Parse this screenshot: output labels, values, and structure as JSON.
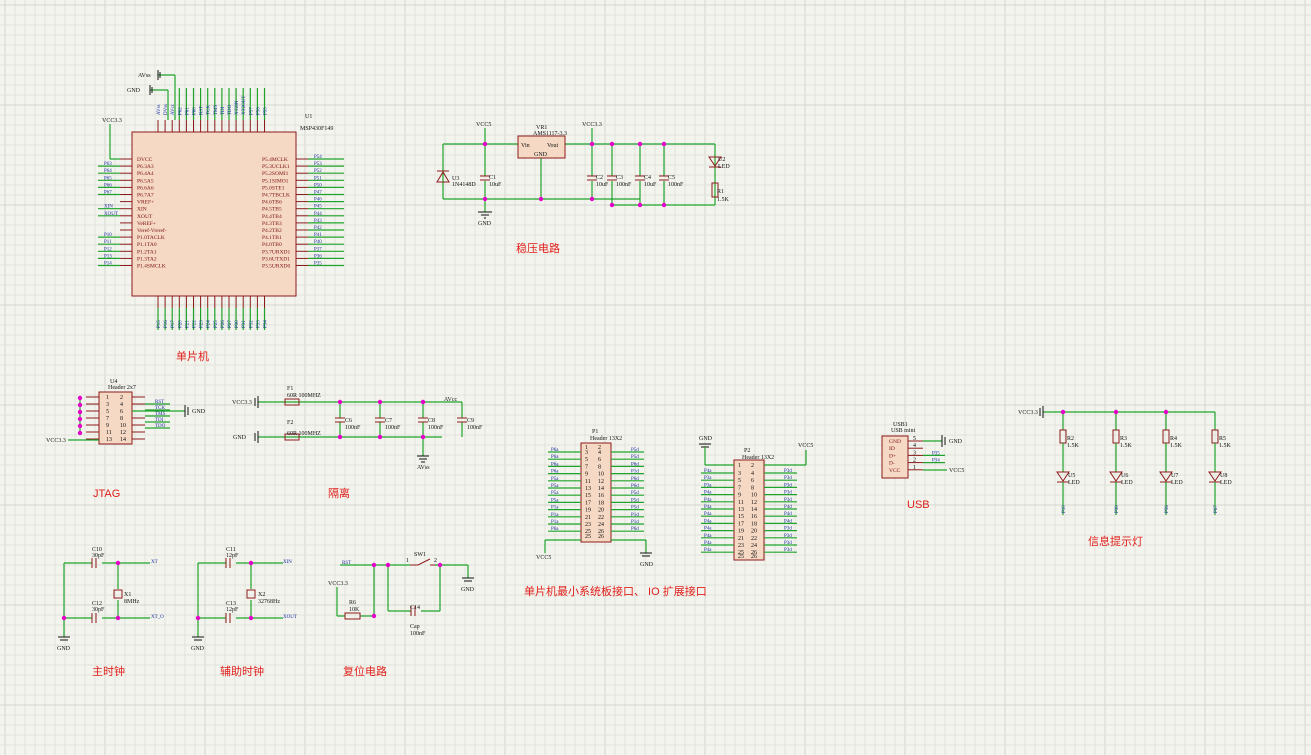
{
  "sections": {
    "mcu": "单片机",
    "regulator": "稳压电路",
    "jtag": "JTAG",
    "isolation": "隔离",
    "usb": "USB",
    "indicator": "信息提示灯",
    "main_clock": "主时钟",
    "aux_clock": "辅助时钟",
    "reset": "复位电路",
    "headers": "单片机最小系统板接口、 IO 扩展接口"
  },
  "mcu": {
    "ref": "U1",
    "part": "MSP430F149",
    "left_pins": [
      "DVCC",
      "P6.3A3",
      "P6.4A4",
      "P6.5A5",
      "P6.6A6",
      "P6.7A7",
      "VREF+",
      "XIN",
      "XOUT",
      "VeREF+",
      "Veref-Vreref-",
      "P1.0TACLK",
      "P1.1TA0",
      "P1.2TA1",
      "P1.3TA2",
      "P1.4SMCLK"
    ],
    "left_nets": [
      "",
      "P63",
      "P64",
      "P65",
      "P66",
      "P67",
      "",
      "XIN",
      "XOUT",
      "",
      "",
      "P10",
      "P11",
      "P12",
      "P13",
      "P14"
    ],
    "right_pins": [
      "P5.4MCLK",
      "P5.3UCLK1",
      "P5.2SOMI1",
      "P5.1SIMO1",
      "P5.0STE1",
      "P4.7TBCLK",
      "P4.6TB6",
      "P4.5TB5",
      "P4.4TB4",
      "P4.3TB3",
      "P4.2TB2",
      "P4.1TB1",
      "P4.0TB0",
      "P3.7URXD1",
      "P3.6UTXD1",
      "P3.5URXD0"
    ],
    "right_nets": [
      "P54",
      "P53",
      "P52",
      "P51",
      "P50",
      "P47",
      "P46",
      "P45",
      "P44",
      "P43",
      "P42",
      "P41",
      "P40",
      "P37",
      "P36",
      "P35"
    ],
    "top_nets": [
      "AVss",
      "DVss",
      "AVcc",
      "P62",
      "P61",
      "P60",
      "RST",
      "TCK",
      "TMS",
      "TDI",
      "TDO",
      "XT2IN",
      "XT2OUT",
      "P57",
      "P56",
      "P55"
    ],
    "bottom_nets": [
      "P15",
      "P16",
      "P17",
      "P20",
      "P21",
      "P22",
      "P23",
      "P24",
      "P25",
      "P26",
      "P27",
      "P30",
      "P31",
      "P32",
      "P33",
      "P34"
    ],
    "labels": [
      "AVss",
      "GND",
      "VCC3.3"
    ]
  },
  "regulator": {
    "vr": "VR1",
    "vr_part": "AMS1117-3.3",
    "vin": "Vin",
    "vout": "Vout",
    "gnd": "GND",
    "vcc5": "VCC5",
    "vcc33": "VCC3.3",
    "diode": "U3",
    "diode_part": "1N4148D",
    "caps": [
      {
        "ref": "C1",
        "val": "10uF"
      },
      {
        "ref": "C2",
        "val": "10uF"
      },
      {
        "ref": "C3",
        "val": "100nF"
      },
      {
        "ref": "C4",
        "val": "10uF"
      },
      {
        "ref": "C5",
        "val": "100nF"
      }
    ],
    "led": "U2",
    "led_label": "LED",
    "res": "R1",
    "res_val": "1.5K",
    "ground": "GND"
  },
  "jtag": {
    "ref": "U4",
    "part": "Header 2x7",
    "nets": [
      "RST",
      "TCK",
      "TMS",
      "TDI",
      "TDO"
    ],
    "gnd": "GND",
    "vcc": "VCC3.3"
  },
  "isolation": {
    "f1": "F1",
    "f1_val": "60R 100MHZ",
    "f2": "F2",
    "f2_val": "60R 100MHZ",
    "vcc": "VCC3.3",
    "gnd": "GND",
    "avcc": "AVcc",
    "avss": "AVss",
    "caps": [
      {
        "ref": "C6",
        "val": "100nF"
      },
      {
        "ref": "C7",
        "val": "100nF"
      },
      {
        "ref": "C8",
        "val": "100nF"
      },
      {
        "ref": "C9",
        "val": "100nF"
      }
    ]
  },
  "p1": {
    "ref": "P1",
    "part": "Header 13X2",
    "left_nets": [
      "P6a",
      "P6a",
      "P6a",
      "P6a",
      "P5a",
      "P5a",
      "P5a",
      "P5a",
      "P1a",
      "P1a",
      "P1a",
      "P6a"
    ],
    "right_nets": [
      "P5d",
      "P5d",
      "P6d",
      "P1d",
      "P6d",
      "P6d",
      "P5d",
      "P5d",
      "P5d",
      "P1d",
      "P1d",
      "P6d"
    ],
    "vcc": "VCC5",
    "gnd": "GND"
  },
  "p2": {
    "ref": "P2",
    "part": "Header 13X2",
    "left_nets": [
      "P4a",
      "P3a",
      "P3a",
      "P4a",
      "P4a",
      "P4a",
      "P4a",
      "P4a",
      "P4a",
      "P4a",
      "P4a",
      "P4a"
    ],
    "right_nets": [
      "P3d",
      "P3d",
      "P3d",
      "P3d",
      "P3d",
      "P4d",
      "P4d",
      "P4d",
      "P3d",
      "P3d",
      "P3d",
      "P3d"
    ],
    "vcc": "VCC5",
    "gnd": "GND"
  },
  "usb": {
    "ref": "USB1",
    "part": "USB mini",
    "pins": [
      "GND",
      "ID",
      "D+",
      "D-",
      "VCC"
    ],
    "nums": [
      "5",
      "4",
      "3",
      "2",
      "1"
    ],
    "nets": [
      "P35",
      "P34"
    ],
    "gnd": "GND",
    "vcc": "VCC5"
  },
  "indicator": {
    "vcc": "VCC3.3",
    "res": [
      {
        "ref": "R2",
        "val": "1.5K"
      },
      {
        "ref": "R3",
        "val": "1.5K"
      },
      {
        "ref": "R4",
        "val": "1.5K"
      },
      {
        "ref": "R5",
        "val": "1.5K"
      }
    ],
    "leds": [
      {
        "ref": "U5",
        "val": "LED"
      },
      {
        "ref": "U6",
        "val": "LED"
      },
      {
        "ref": "U7",
        "val": "LED"
      },
      {
        "ref": "U8",
        "val": "LED"
      }
    ],
    "nets": [
      "P10",
      "P30",
      "P56",
      "P67"
    ]
  },
  "main_clock": {
    "c10": "C10",
    "c10_val": "30pF",
    "c12": "C12",
    "c12_val": "30pF",
    "x1": "X1",
    "x1_val": "8MHz",
    "xt": "XT",
    "xto": "XT_O",
    "gnd": "GND"
  },
  "aux_clock": {
    "c11": "C11",
    "c11_val": "12pF",
    "c13": "C13",
    "c13_val": "12pF",
    "x2": "X2",
    "x2_val": "32768Hz",
    "xin": "XIN",
    "xout": "XOUT",
    "gnd": "GND"
  },
  "reset": {
    "rst": "RST",
    "sw": "SW1",
    "vcc": "VCC3.3",
    "r6": "R6",
    "r6_val": "10K",
    "c14": "C14",
    "c14_type": "Cap",
    "c14_val": "100nF",
    "gnd": "GND",
    "pin1": "1",
    "pin2": "2"
  }
}
